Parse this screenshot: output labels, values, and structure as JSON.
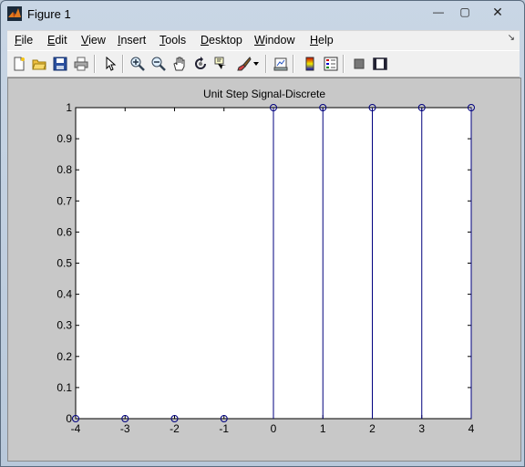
{
  "window": {
    "title": "Figure 1",
    "controls": {
      "minimize": "—",
      "maximize": "▢",
      "close": "✕"
    }
  },
  "menubar": {
    "items": [
      {
        "label": "File",
        "accel": "F",
        "rest": "ile"
      },
      {
        "label": "Edit",
        "accel": "E",
        "rest": "dit"
      },
      {
        "label": "View",
        "accel": "V",
        "rest": "iew"
      },
      {
        "label": "Insert",
        "accel": "I",
        "rest": "nsert"
      },
      {
        "label": "Tools",
        "accel": "T",
        "rest": "ools"
      },
      {
        "label": "Desktop",
        "accel": "D",
        "rest": "esktop"
      },
      {
        "label": "Window",
        "accel": "W",
        "rest": "indow"
      },
      {
        "label": "Help",
        "accel": "H",
        "rest": "elp"
      }
    ],
    "dock_arrow": "↘"
  },
  "toolbar": {
    "icons": [
      "new-figure-icon",
      "open-file-icon",
      "save-icon",
      "print-icon",
      "edit-plot-arrow-icon",
      "zoom-in-icon",
      "zoom-out-icon",
      "pan-hand-icon",
      "rotate-3d-icon",
      "data-cursor-icon",
      "brush-icon",
      "brush-dropdown-icon",
      "link-plot-icon",
      "insert-colorbar-icon",
      "insert-legend-icon",
      "hide-plot-tools-icon",
      "show-plot-tools-icon"
    ]
  },
  "colors": {
    "stem": "#00007f",
    "axes_bg": "#ffffff",
    "figure_bg": "#c8c8c8"
  },
  "chart_data": {
    "type": "stem",
    "title": "Unit Step Signal-Discrete",
    "xlabel": "",
    "ylabel": "",
    "x": [
      -4,
      -3,
      -2,
      -1,
      0,
      1,
      2,
      3,
      4
    ],
    "y": [
      0,
      0,
      0,
      0,
      1,
      1,
      1,
      1,
      1
    ],
    "xlim": [
      -4,
      4
    ],
    "ylim": [
      0,
      1
    ],
    "xticks": [
      "-4",
      "-3",
      "-2",
      "-1",
      "0",
      "1",
      "2",
      "3",
      "4"
    ],
    "yticks": [
      "0",
      "0.1",
      "0.2",
      "0.3",
      "0.4",
      "0.5",
      "0.6",
      "0.7",
      "0.8",
      "0.9",
      "1"
    ],
    "grid": false,
    "marker": "circle"
  }
}
